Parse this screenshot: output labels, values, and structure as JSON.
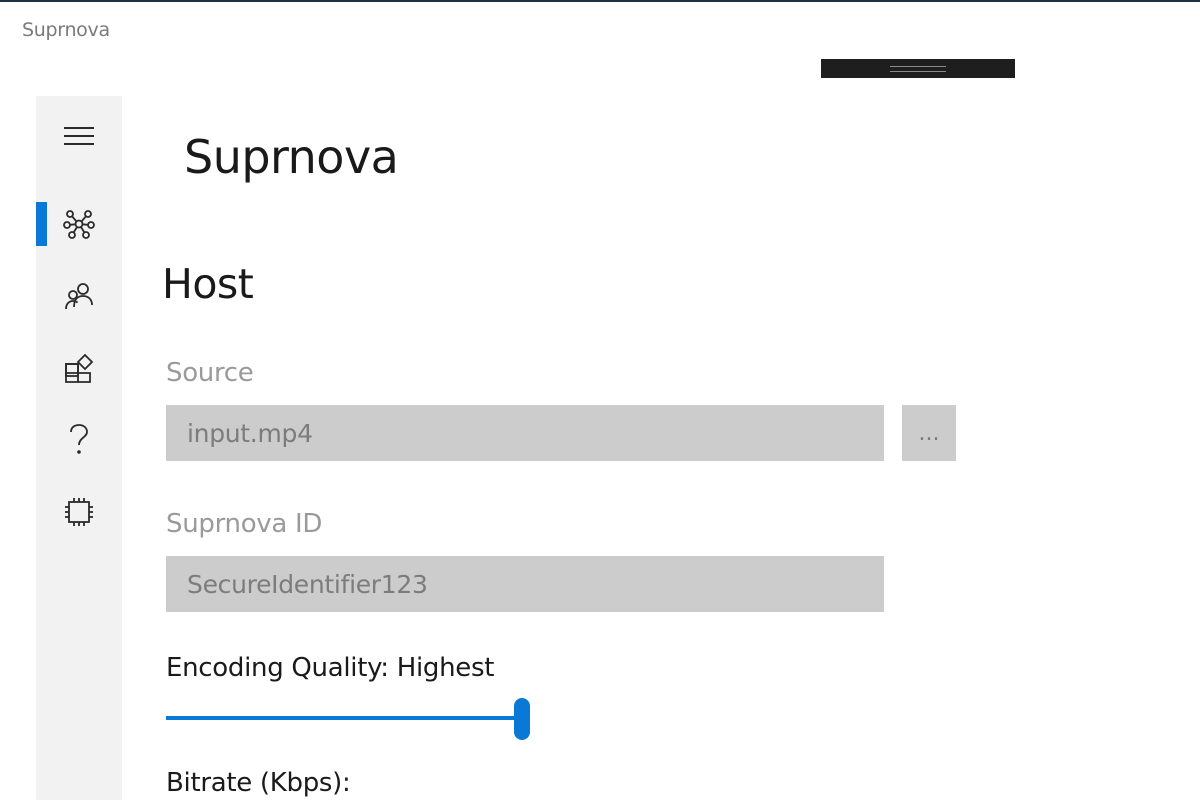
{
  "window": {
    "title": "Suprnova"
  },
  "nav": {
    "items": [
      {
        "icon": "hamburger-menu-icon",
        "active": false
      },
      {
        "icon": "network-icon",
        "active": true
      },
      {
        "icon": "people-icon",
        "active": false
      },
      {
        "icon": "apps-add-icon",
        "active": false
      },
      {
        "icon": "help-icon",
        "active": false
      },
      {
        "icon": "processor-chip-icon",
        "active": false
      }
    ]
  },
  "header": {
    "app_title": "Suprnova"
  },
  "host": {
    "section_title": "Host",
    "source_label": "Source",
    "source_value": "input.mp4",
    "browse_label": "...",
    "id_label": "Suprnova ID",
    "id_value": "SecureIdentifier123",
    "quality_label": "Encoding Quality: Highest",
    "quality_level": 1.0,
    "bitrate_label": "Bitrate (Kbps):"
  },
  "colors": {
    "accent": "#0a78d7",
    "rail_bg": "#f2f2f2",
    "field_bg": "#cccccc"
  }
}
